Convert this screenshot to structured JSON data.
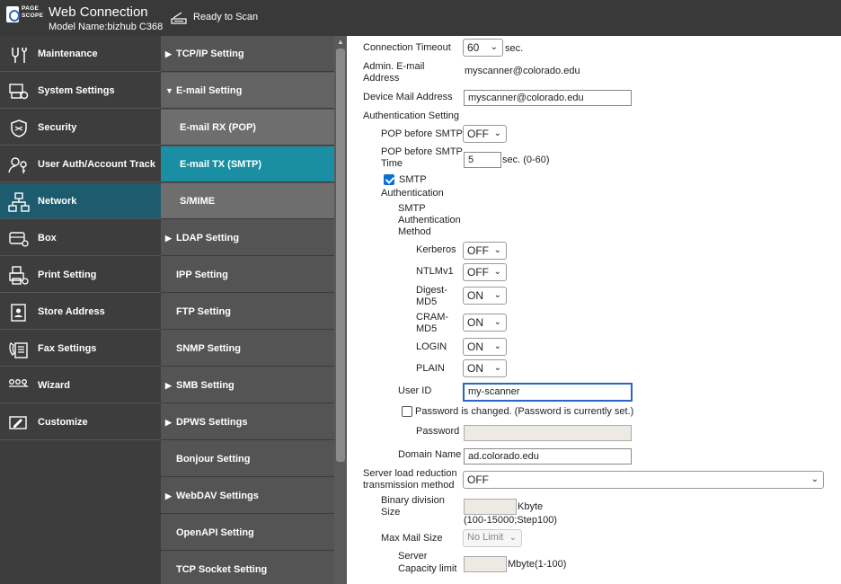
{
  "header": {
    "logo_text": "PAGE SCOPE",
    "app_title": "Web Connection",
    "model": "Model Name:bizhub C368",
    "status": "Ready to Scan"
  },
  "nav": {
    "items": [
      {
        "label": "Maintenance",
        "icon": "wrench-icon"
      },
      {
        "label": "System Settings",
        "icon": "system-settings-icon"
      },
      {
        "label": "Security",
        "icon": "shield-icon"
      },
      {
        "label": "User Auth/Account Track",
        "icon": "user-key-icon"
      },
      {
        "label": "Network",
        "icon": "network-icon"
      },
      {
        "label": "Box",
        "icon": "box-icon"
      },
      {
        "label": "Print Setting",
        "icon": "printer-icon"
      },
      {
        "label": "Store Address",
        "icon": "address-book-icon"
      },
      {
        "label": "Fax Settings",
        "icon": "fax-icon"
      },
      {
        "label": "Wizard",
        "icon": "wizard-icon"
      },
      {
        "label": "Customize",
        "icon": "customize-icon"
      }
    ]
  },
  "subnav": {
    "items": [
      {
        "label": "TCP/IP Setting"
      },
      {
        "label": "E-mail Setting"
      },
      {
        "label": "E-mail RX (POP)"
      },
      {
        "label": "E-mail TX (SMTP)"
      },
      {
        "label": "S/MIME"
      },
      {
        "label": "LDAP Setting"
      },
      {
        "label": "IPP Setting"
      },
      {
        "label": "FTP Setting"
      },
      {
        "label": "SNMP Setting"
      },
      {
        "label": "SMB Setting"
      },
      {
        "label": "DPWS Settings"
      },
      {
        "label": "Bonjour Setting"
      },
      {
        "label": "WebDAV Settings"
      },
      {
        "label": "OpenAPI Setting"
      },
      {
        "label": "TCP Socket Setting"
      }
    ]
  },
  "form": {
    "connection_timeout": {
      "label": "Connection Timeout",
      "value": "60",
      "unit": "sec."
    },
    "admin_email": {
      "label_1": "Admin. E-mail",
      "label_2": "Address",
      "value": "myscanner@colorado.edu"
    },
    "device_mail": {
      "label": "Device Mail Address",
      "value": "myscanner@colorado.edu"
    },
    "auth_setting": {
      "label": "Authentication Setting"
    },
    "pop_before_smtp": {
      "label": "POP before SMTP",
      "value": "OFF"
    },
    "pop_before_smtp_time": {
      "label_1": "POP before SMTP",
      "label_2": "Time",
      "value": "5",
      "unit": "sec. (0-60)"
    },
    "smtp_auth": {
      "label_1": "SMTP",
      "label_2": "Authentication",
      "checked": true
    },
    "smtp_auth_method": {
      "label_1": "SMTP",
      "label_2": "Authentication",
      "label_3": "Method"
    },
    "kerberos": {
      "label": "Kerberos",
      "value": "OFF"
    },
    "ntlmv1": {
      "label": "NTLMv1",
      "value": "OFF"
    },
    "digest_md5": {
      "label_1": "Digest-",
      "label_2": "MD5",
      "value": "ON"
    },
    "cram_md5": {
      "label_1": "CRAM-",
      "label_2": "MD5",
      "value": "ON"
    },
    "login": {
      "label": "LOGIN",
      "value": "ON"
    },
    "plain": {
      "label": "PLAIN",
      "value": "ON"
    },
    "user_id": {
      "label": "User ID",
      "value": "my-scanner"
    },
    "password_changed": {
      "label": "Password is changed.  (Password is currently set.)",
      "checked": false
    },
    "password": {
      "label": "Password",
      "value": ""
    },
    "domain_name": {
      "label": "Domain Name",
      "value": "ad.colorado.edu"
    },
    "server_load_reduction": {
      "label_1": "Server load reduction",
      "label_2": "transmission method",
      "value": "OFF"
    },
    "binary_division": {
      "label_1": "Binary division",
      "label_2": "Size",
      "value": "",
      "unit": "Kbyte",
      "range": "(100-15000;Step100)"
    },
    "max_mail_size": {
      "label": "Max Mail Size",
      "value": "No Limit"
    },
    "server_capacity": {
      "label_1": "Server",
      "label_2": "Capacity limit",
      "value": "",
      "unit": "Mbyte(1-100)"
    }
  }
}
